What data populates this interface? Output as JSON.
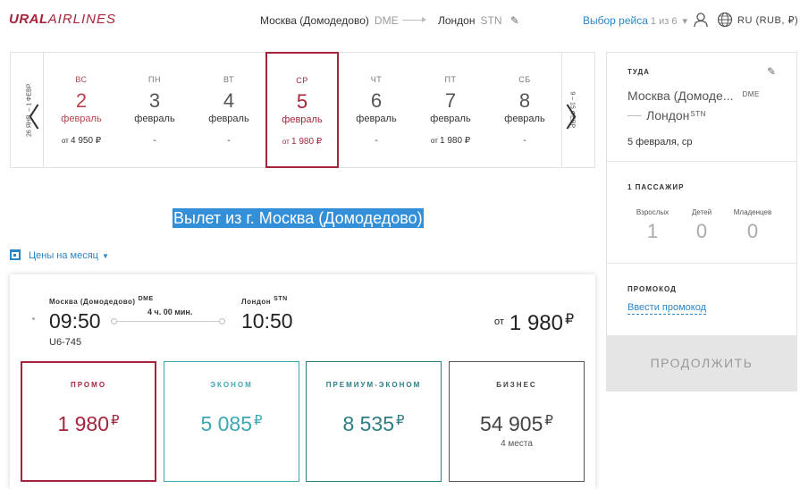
{
  "header": {
    "logo_bold": "URAL",
    "logo_light": "AIRLINES",
    "route_from": "Москва (Домодедово)",
    "route_from_code": "DME",
    "route_to": "Лондон",
    "route_to_code": "STN",
    "flight_select_label": "Выбор рейса",
    "flight_select_step": "1 из 6",
    "language": "RU (RUB, ₽)"
  },
  "calendar": {
    "prev_range": "26 ЯНВ. – 1 ФЕВР.",
    "next_range": "9 – 15 ФЕВР.",
    "days": [
      {
        "dow": "ВС",
        "num": "2",
        "month": "февраль",
        "price_prefix": "от",
        "price": "4 950 ₽"
      },
      {
        "dow": "ПН",
        "num": "3",
        "month": "февраль",
        "price_prefix": "",
        "price": "-"
      },
      {
        "dow": "ВТ",
        "num": "4",
        "month": "февраль",
        "price_prefix": "",
        "price": "-"
      },
      {
        "dow": "СР",
        "num": "5",
        "month": "февраль",
        "price_prefix": "от",
        "price": "1 980 ₽"
      },
      {
        "dow": "ЧТ",
        "num": "6",
        "month": "февраль",
        "price_prefix": "",
        "price": "-"
      },
      {
        "dow": "ПТ",
        "num": "7",
        "month": "февраль",
        "price_prefix": "от",
        "price": "1 980 ₽"
      },
      {
        "dow": "СБ",
        "num": "8",
        "month": "февраль",
        "price_prefix": "",
        "price": "-"
      }
    ]
  },
  "main": {
    "departure_heading": "Вылет из г. Москва (Домодедово)",
    "month_prices": "Цены на месяц"
  },
  "flight": {
    "from_city": "Москва (Домодедово)",
    "from_code": "DME",
    "to_city": "Лондон",
    "to_code": "STN",
    "dep_time": "09:50",
    "arr_time": "10:50",
    "duration": "4 ч. 00 мин.",
    "flight_number": "U6-745",
    "from_label": "от",
    "min_price": "1 980",
    "currency": "₽",
    "fares": [
      {
        "title": "ПРОМО",
        "price": "1 980",
        "seats": ""
      },
      {
        "title": "ЭКОНОМ",
        "price": "5 085",
        "seats": ""
      },
      {
        "title": "ПРЕМИУМ-ЭКОНОМ",
        "price": "8 535",
        "seats": ""
      },
      {
        "title": "БИЗНЕС",
        "price": "54 905",
        "seats": "4 места"
      }
    ]
  },
  "sidebar": {
    "direction_label": "ТУДА",
    "from_city": "Москва (Домоде...",
    "from_code": "DME",
    "to_city": "Лондон",
    "to_code": "STN",
    "date": "5 февраля, ср",
    "passengers_label": "1 ПАССАЖИР",
    "adults_label": "Взрослых",
    "adults": "1",
    "children_label": "Детей",
    "children": "0",
    "infants_label": "Младенцев",
    "infants": "0",
    "promo_label": "ПРОМОКОД",
    "promo_link": "Ввести промокод",
    "continue": "ПРОДОЛЖИТЬ"
  },
  "colors": {
    "brand": "#a5243b",
    "link": "#2a86c6",
    "econom": "#3ba7b0",
    "premium": "#2d7d84"
  }
}
